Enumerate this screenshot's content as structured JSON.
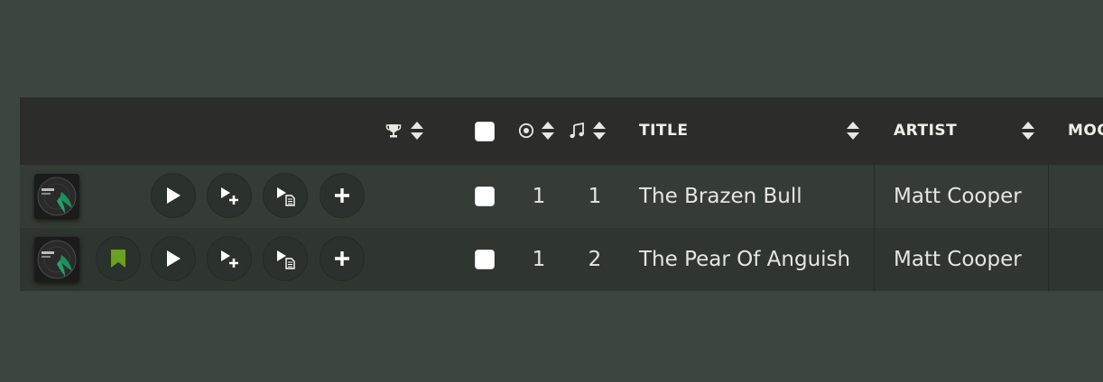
{
  "header": {
    "rank_icon": "trophy-icon",
    "rating_icon": "record-icon",
    "track_icon": "music-note-icon",
    "title_label": "TITLE",
    "artist_label": "ARTIST",
    "mood_label": "MOOD"
  },
  "row_actions": {
    "bookmark_icon": "bookmark-icon",
    "play_icon": "play-icon",
    "play_next_icon": "play-add-icon",
    "play_playlist_icon": "play-list-icon",
    "add_icon": "plus-icon"
  },
  "rows": [
    {
      "disc": "1",
      "track": "1",
      "title": "The Brazen Bull",
      "artist": "Matt Cooper",
      "bookmarked": false
    },
    {
      "disc": "1",
      "track": "2",
      "title": "The Pear Of Anguish",
      "artist": "Matt Cooper",
      "bookmarked": true
    }
  ],
  "colors": {
    "background": "#3c463e",
    "header_bg": "#2c2c2a",
    "bookmark": "#6aa121"
  }
}
